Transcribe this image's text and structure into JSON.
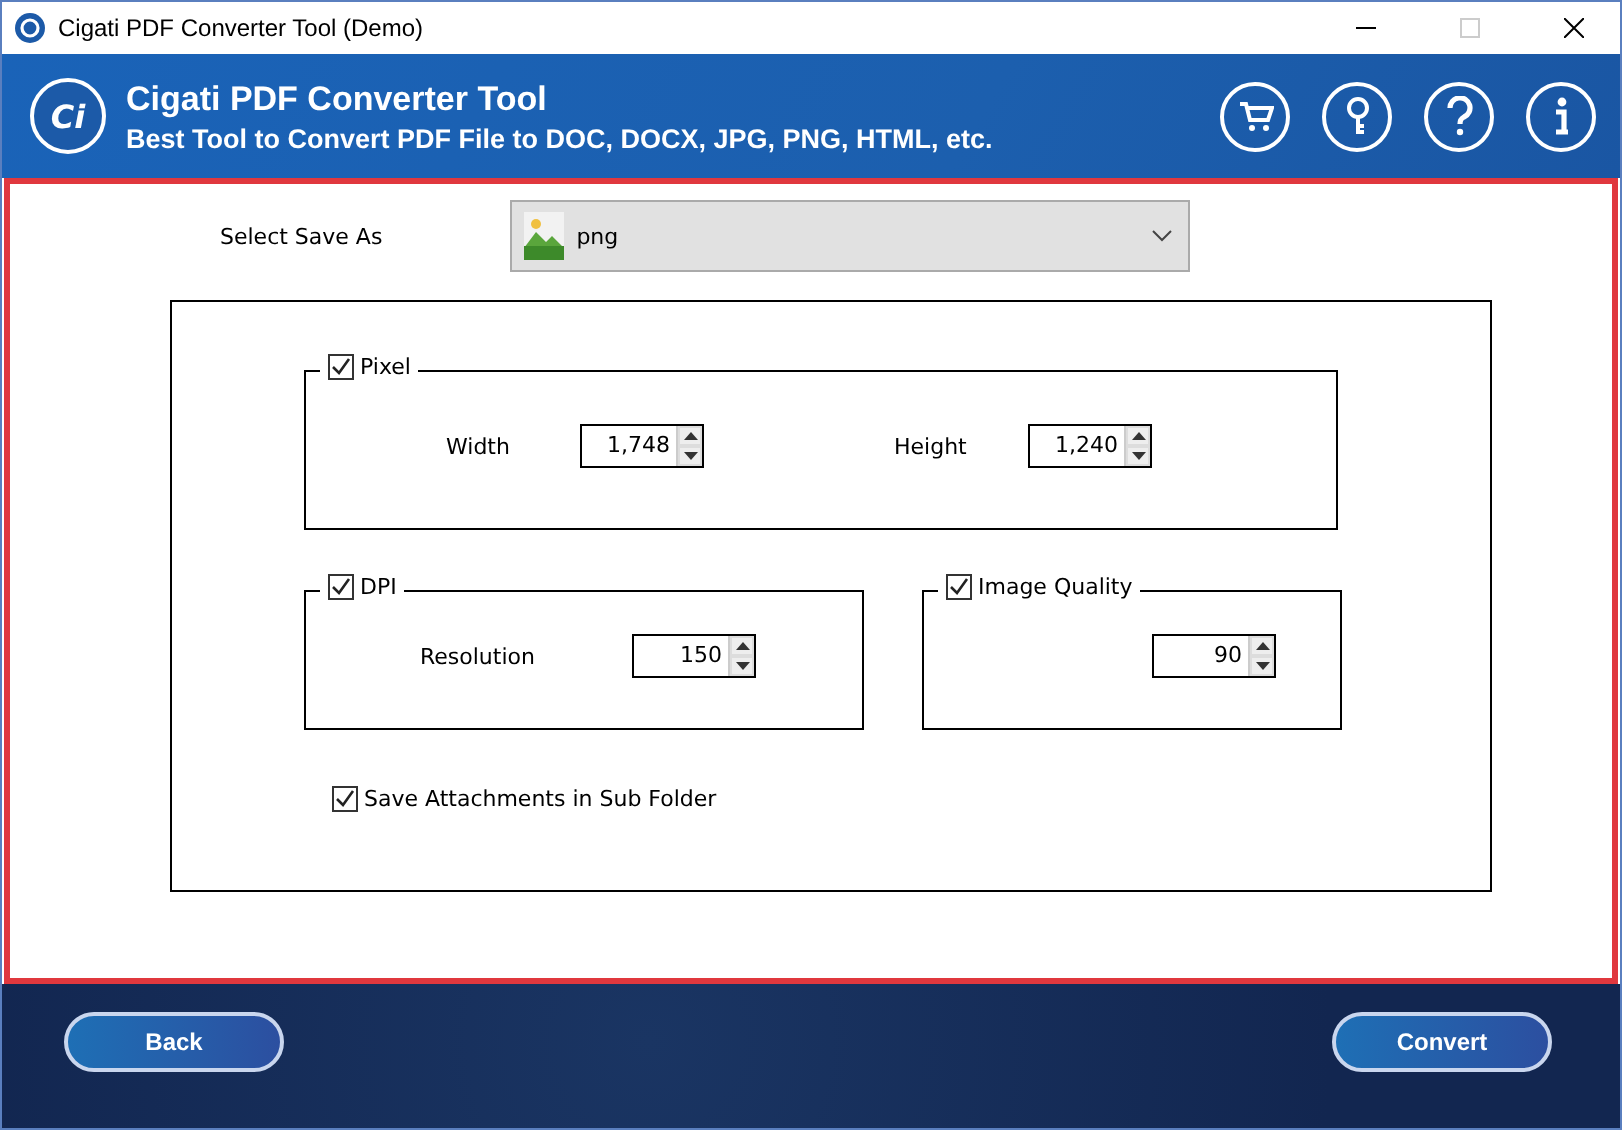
{
  "window": {
    "title": "Cigati PDF Converter Tool (Demo)"
  },
  "header": {
    "title": "Cigati PDF Converter Tool",
    "subtitle": "Best Tool to Convert PDF File to DOC, DOCX, JPG, PNG, HTML, etc.",
    "logo": "Ci"
  },
  "save_as": {
    "label": "Select Save As",
    "value": "png"
  },
  "groups": [
    {
      "label": "Pixel",
      "checked": true,
      "fields": [
        {
          "label": "Width",
          "value": "1,748"
        },
        {
          "label": "Height",
          "value": "1,240"
        }
      ]
    },
    {
      "label": "DPI",
      "checked": true,
      "fields": [
        {
          "label": "Resolution",
          "value": "150"
        }
      ]
    },
    {
      "label": "Image Quality",
      "checked": true,
      "fields": [
        {
          "value": "90"
        }
      ]
    }
  ],
  "save_attachments": {
    "label": "Save Attachments in Sub Folder",
    "checked": true
  },
  "buttons": {
    "back": "Back",
    "convert": "Convert"
  }
}
